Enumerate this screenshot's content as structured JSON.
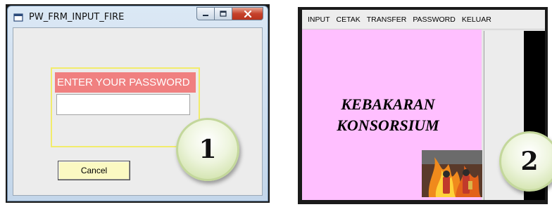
{
  "window1": {
    "title": "PW_FRM_INPUT_FIRE",
    "password_label": "ENTER YOUR PASSWORD",
    "password_value": "",
    "cancel_label": "Cancel"
  },
  "window2": {
    "menu": [
      "INPUT",
      "CETAK",
      "TRANSFER",
      "PASSWORD",
      "KELUAR"
    ],
    "brand_line1": "KEBAKARAN",
    "brand_line2": "KONSORSIUM"
  },
  "bubbles": [
    "1",
    "2"
  ],
  "colors": {
    "password_label_bg": "#f08080",
    "password_group_border": "#f2ec6b",
    "cancel_bg": "#fbf9c2",
    "brand_panel_bg": "#ffbfff",
    "bubble_fill": "#d2e3ad"
  },
  "icons": [
    "app-window-icon",
    "minimize-icon",
    "maximize-icon",
    "close-icon",
    "firefighter-photo"
  ]
}
